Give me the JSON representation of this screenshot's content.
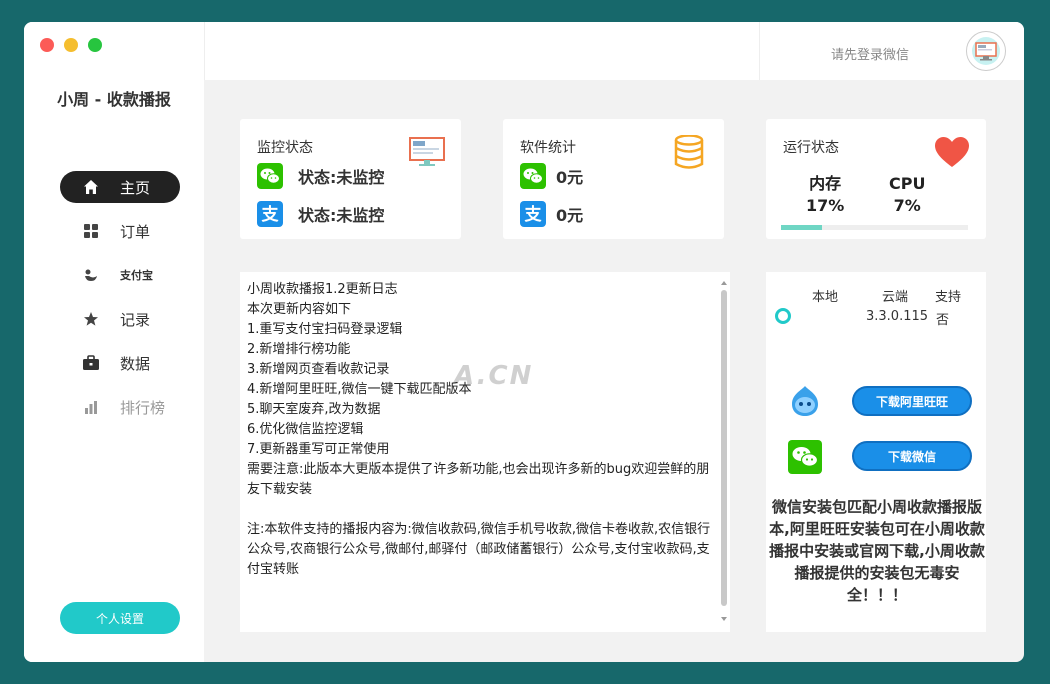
{
  "app": {
    "title": "小周 - 收款播报"
  },
  "colors": {
    "accent": "#21c9c9",
    "background": "#17686b",
    "active_nav": "#222222",
    "download_blue": "#1a8fe8",
    "heart": "#f05545",
    "coin": "#f5a623",
    "wechat": "#2dc100",
    "alipay": "#1a8fe8"
  },
  "sidebar": {
    "items": [
      {
        "label": "主页",
        "icon": "home-icon",
        "active": true
      },
      {
        "label": "订单",
        "icon": "grid-icon"
      },
      {
        "label": "支付宝",
        "icon": "alipay-mini-icon"
      },
      {
        "label": "记录",
        "icon": "star-icon"
      },
      {
        "label": "数据",
        "icon": "briefcase-icon"
      },
      {
        "label": "排行榜",
        "icon": "bar-chart-icon",
        "disabled": true
      }
    ],
    "settings_label": "个人设置"
  },
  "header": {
    "login_text": "请先登录微信",
    "avatar_icon": "monitor-icon"
  },
  "monitor_card": {
    "title": "监控状态",
    "icon": "monitor-icon",
    "wechat_status": "状态:未监控",
    "alipay_status": "状态:未监控"
  },
  "stats_card": {
    "title": "软件统计",
    "icon": "database-icon",
    "wechat_amount": "0元",
    "alipay_amount": "0元"
  },
  "run_card": {
    "title": "运行状态",
    "icon": "heart-icon",
    "mem_label": "内存",
    "mem_value": "17%",
    "cpu_label": "CPU",
    "cpu_value": "7%",
    "progress": 0.22
  },
  "changelog": {
    "watermark": "A.CN",
    "text": "小周收款播报1.2更新日志\n本次更新内容如下\n1.重写支付宝扫码登录逻辑\n2.新增排行榜功能\n3.新增网页查看收款记录\n4.新增阿里旺旺,微信一键下载匹配版本\n5.聊天室废弃,改为数据\n6.优化微信监控逻辑\n7.更新器重写可正常使用\n需要注意:此版本大更版本提供了许多新功能,也会出现许多新的bug欢迎尝鲜的朋友下载安装\n\n注:本软件支持的播报内容为:微信收款码,微信手机号收款,微信卡卷收款,农信银行公众号,农商银行公众号,微邮付,邮驿付（邮政储蓄银行）公众号,支付宝收款码,支付宝转账"
  },
  "version_panel": {
    "col_local": "本地",
    "col_cloud": "云端",
    "col_support": "支持",
    "cloud_version": "3.3.0.115",
    "supported": "否",
    "download_wangwang": "下载阿里旺旺",
    "download_wechat": "下载微信",
    "note": "微信安装包匹配小周收款播报版本,阿里旺旺安装包可在小周收款播报中安装或官网下载,小周收款播报提供的安装包无毒安全！！！"
  }
}
